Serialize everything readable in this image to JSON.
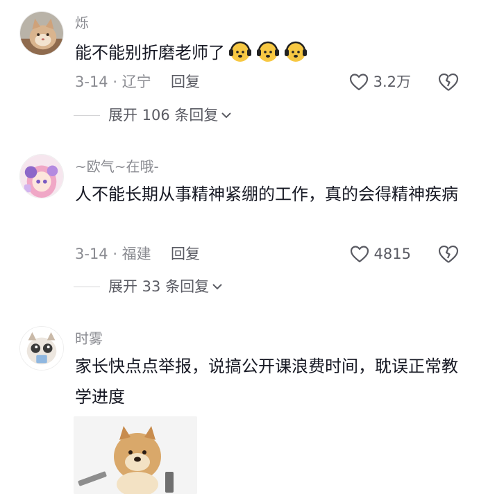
{
  "comments": [
    {
      "username": "烁",
      "text": "能不能别折磨老师了",
      "emojis": [
        "dog-headphones-emoji",
        "dog-headphones-emoji",
        "dog-headphones-emoji"
      ],
      "date_location": "3-14 · 辽宁",
      "reply_label": "回复",
      "likes": "3.2万",
      "expand_label": "展开 106 条回复"
    },
    {
      "username": "~欧气~在哦-",
      "text": "人不能长期从事精神紧绷的工作，真的会得精神疾病",
      "date_location": "3-14 · 福建",
      "reply_label": "回复",
      "likes": "4815",
      "expand_label": "展开 33 条回复"
    },
    {
      "username": "时雾",
      "text": "家长快点点举报，说搞公开课浪费时间，耽误正常教学进度",
      "attachment": "doge-meme-image"
    }
  ],
  "colors": {
    "text_primary": "#161823",
    "text_secondary": "#8a8b91",
    "action_text": "#5a5b63",
    "divider": "#d4d4d6"
  }
}
